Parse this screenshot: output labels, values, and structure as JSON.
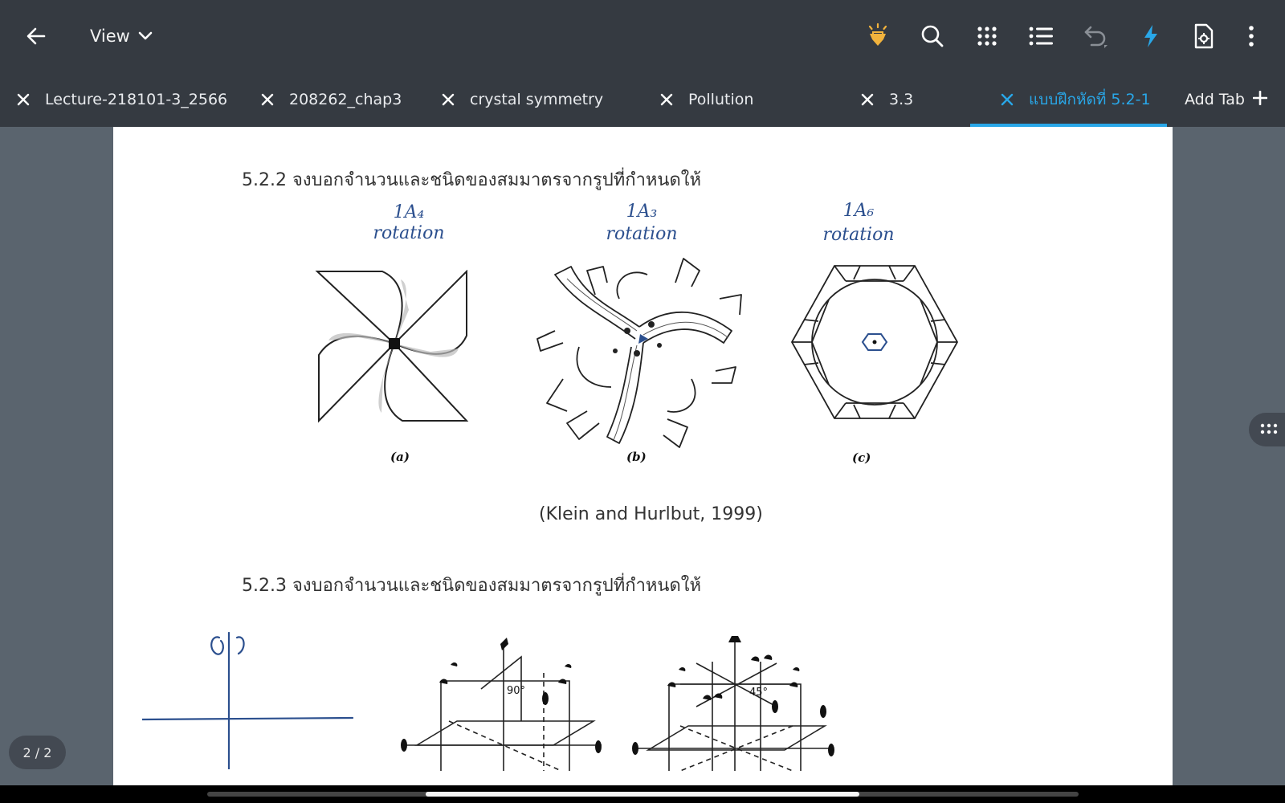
{
  "toolbar": {
    "view_label": "View",
    "icons": [
      "back-arrow-icon",
      "chevron-down-icon",
      "highlighter-icon",
      "search-icon",
      "grid-icon",
      "list-icon",
      "undo-icon",
      "flash-icon",
      "page-settings-icon",
      "more-vert-icon"
    ],
    "accent_color": "#29a7e8",
    "highlight_color": "#f2b33d"
  },
  "tabs": [
    {
      "label": "Lecture-218101-3_2566",
      "active": false
    },
    {
      "label": "208262_chap3",
      "active": false
    },
    {
      "label": "crystal symmetry",
      "active": false
    },
    {
      "label": "Pollution",
      "active": false
    },
    {
      "label": "3.3",
      "active": false
    },
    {
      "label": "แบบฝึกหัดที่ 5.2-1",
      "active": true
    }
  ],
  "add_tab_label": "Add Tab",
  "document": {
    "q1_heading": "5.2.2 จงบอกจำนวนและชนิดของสมมาตรจากรูปที่กำหนดให้",
    "annotations": [
      {
        "line1": "1A₄",
        "line2": "rotation"
      },
      {
        "line1": "1A₃",
        "line2": "rotation"
      },
      {
        "line1": "1A₆",
        "line2": "rotation"
      }
    ],
    "figure_labels": [
      "(a)",
      "(b)",
      "(c)"
    ],
    "citation": "(Klein and Hurlbut, 1999)",
    "q2_heading": "5.2.3 จงบอกจำนวนและชนิดของสมมาตรจากรูปที่กำหนดให้",
    "angle_labels": [
      "90°",
      "45°"
    ]
  },
  "page_indicator": "2 / 2"
}
